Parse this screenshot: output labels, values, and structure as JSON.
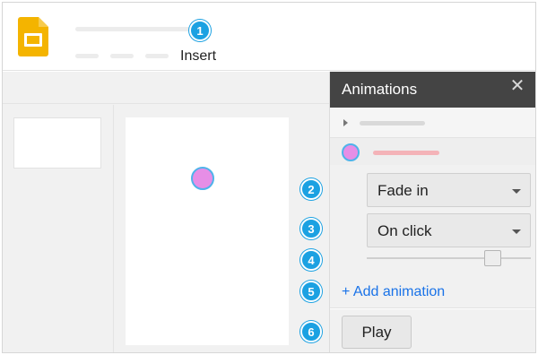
{
  "menu": {
    "insert_label": "Insert"
  },
  "panel": {
    "title": "Animations",
    "close_icon": "close-icon",
    "effect_value": "Fade in",
    "trigger_value": "On click",
    "speed_level": 0.77,
    "add_label": "+ Add animation",
    "play_label": "Play"
  },
  "badges": [
    "1",
    "2",
    "3",
    "4",
    "5",
    "6"
  ],
  "colors": {
    "badge": "#1ba1e2",
    "panel_header": "#444444",
    "link": "#1a73e8",
    "object_fill": "#e68ee6",
    "object_outline": "#4fb3ea",
    "slides_yellow": "#f4b400"
  }
}
